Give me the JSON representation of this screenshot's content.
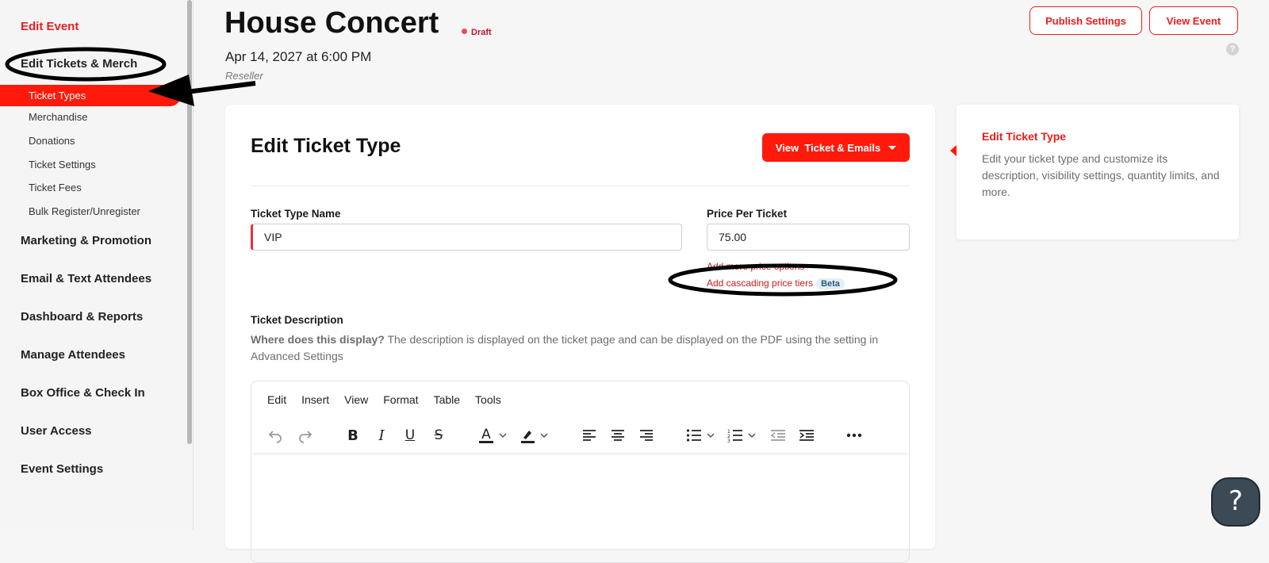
{
  "sidebar": {
    "edit_event": "Edit Event",
    "edit_tickets": "Edit Tickets & Merch",
    "sub_items": [
      "Ticket Types",
      "Merchandise",
      "Donations",
      "Ticket Settings",
      "Ticket Fees",
      "Bulk Register/Unregister"
    ],
    "sections": [
      "Marketing & Promotion",
      "Email & Text Attendees",
      "Dashboard & Reports",
      "Manage Attendees",
      "Box Office & Check In",
      "User Access",
      "Event Settings"
    ]
  },
  "header": {
    "title": "House Concert",
    "status": "Draft",
    "date": "Apr 14, 2027 at 6:00 PM",
    "subtitle": "Reseller",
    "publish_btn": "Publish Settings",
    "view_btn": "View Event",
    "help_small": "?"
  },
  "main": {
    "title": "Edit Ticket Type",
    "view_ticket_btn": "View  Ticket & Emails",
    "name_label": "Ticket Type Name",
    "name_value": "VIP",
    "price_label": "Price Per Ticket",
    "price_value": "75.00",
    "add_price_options": "Add more price options",
    "add_cascading": "Add cascading price tiers",
    "beta": "Beta",
    "desc_label": "Ticket Description",
    "desc_help_bold": "Where does this display?",
    "desc_help_text": " The description is displayed on the ticket page and can be displayed on the PDF using the setting in Advanced Settings",
    "editor_menu": [
      "Edit",
      "Insert",
      "View",
      "Format",
      "Table",
      "Tools"
    ]
  },
  "info_panel": {
    "title": "Edit Ticket Type",
    "text": "Edit your ticket type and customize its description, visibility settings, quantity limits, and more."
  },
  "help_fab": "?",
  "colors": {
    "accent": "#ff1a0b",
    "link_red": "#ee1d1d",
    "fab": "#3b4a55"
  }
}
